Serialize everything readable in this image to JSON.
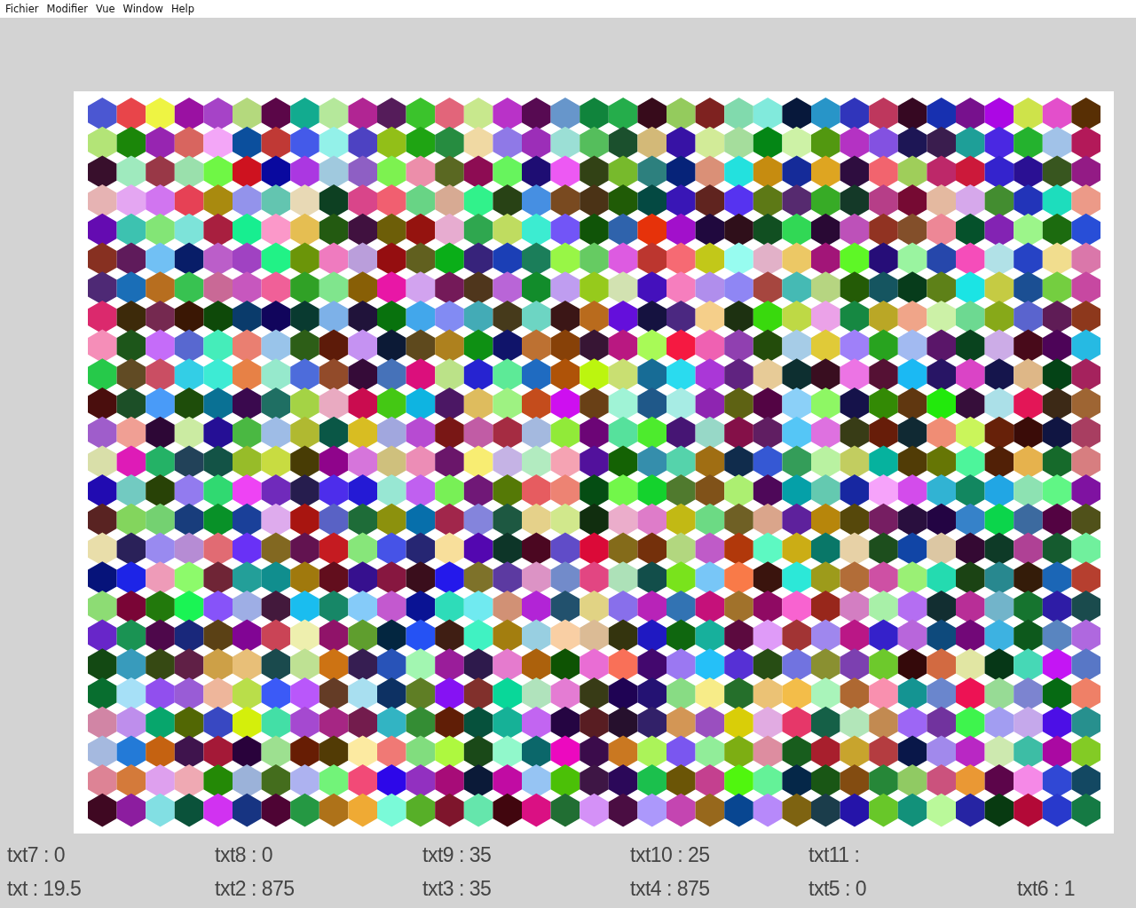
{
  "menu": [
    "Fichier",
    "Modifier",
    "Vue",
    "Window",
    "Help"
  ],
  "readout_rows": [
    [
      "txt7 : 0",
      "txt8 : 0",
      "txt9 : 35",
      "txt10 : 25",
      "txt11 :"
    ],
    [
      "txt : 19.5",
      "txt2 : 875",
      "txt3 : 35",
      "txt4 : 875",
      "txt5 : 0",
      "txt6 : 1"
    ]
  ]
}
